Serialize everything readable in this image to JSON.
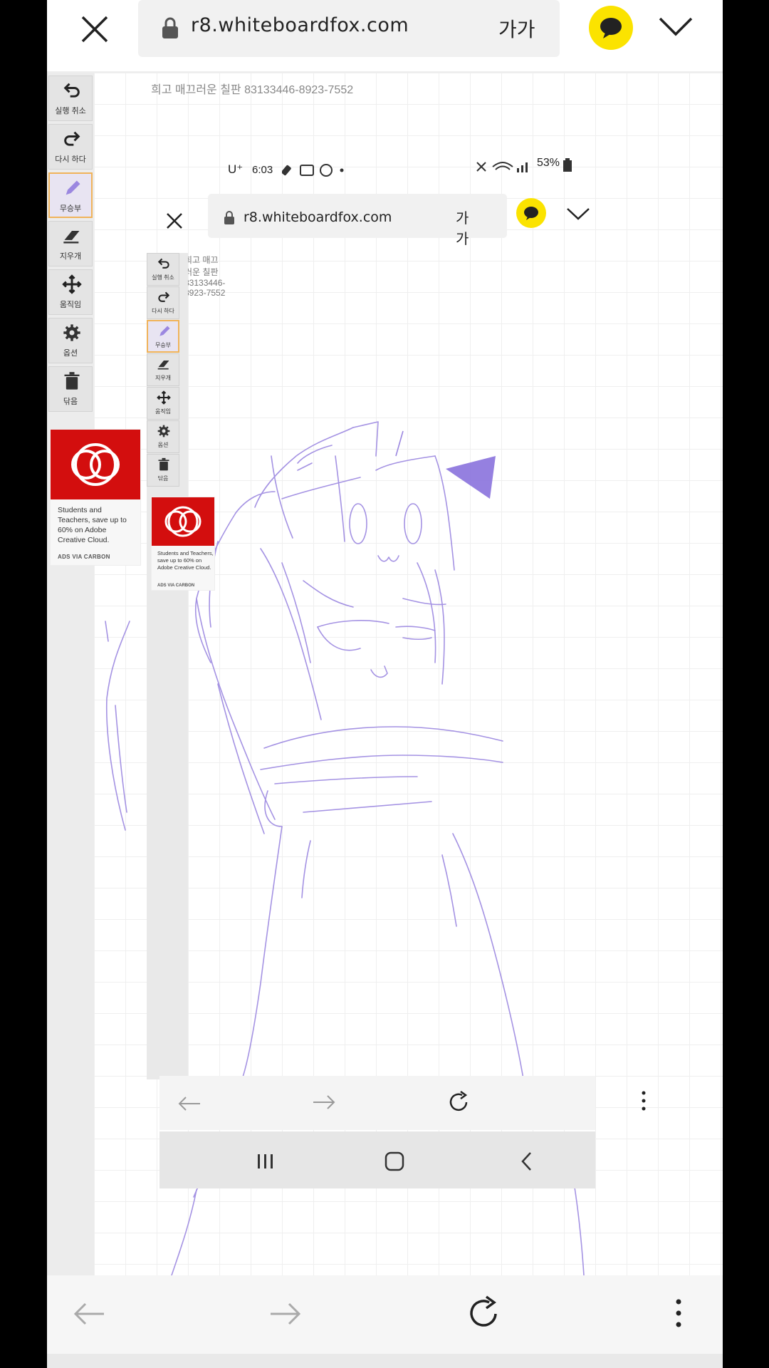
{
  "browser": {
    "url": "r8.whiteboardfox.com",
    "text_size_label": "가가",
    "icons": {
      "close": "close-icon",
      "lock": "lock-icon",
      "chat": "kakao-chat-icon",
      "menu": "chevron-down-icon",
      "back": "arrow-left-icon",
      "forward": "arrow-right-icon",
      "reload": "reload-icon",
      "more": "more-vert-icon"
    },
    "accent_yellow": "#fbe300"
  },
  "board": {
    "title": "희고 매끄러운 칠판 83133446-8923-7552",
    "stroke_color": "#9b87e0"
  },
  "toolbar": {
    "items": [
      {
        "label": "실행 취소",
        "icon": "undo-icon"
      },
      {
        "label": "다시 하다",
        "icon": "redo-icon"
      },
      {
        "label": "무승부",
        "icon": "pencil-icon",
        "active": true
      },
      {
        "label": "지우개",
        "icon": "eraser-icon"
      },
      {
        "label": "움직임",
        "icon": "move-icon"
      },
      {
        "label": "옵션",
        "icon": "gear-icon"
      },
      {
        "label": "닦음",
        "icon": "trash-icon"
      }
    ]
  },
  "ad": {
    "text": "Students and Teachers, save up to 60% on Adobe Creative Cloud.",
    "via": "ADS VIA CARBON",
    "brand_color": "#d30e0e"
  },
  "inner_screenshot": {
    "status_time": "6:03",
    "status_carrier": "U⁺",
    "status_battery": "53%",
    "url": "r8.whiteboardfox.com",
    "text_size_label": "가가",
    "title": "희고 매끄러운 칠판 83133446-8923-7552",
    "toolbar_labels": [
      "실행 취소",
      "다시 하다",
      "무승부",
      "지우개",
      "움직임",
      "옵션",
      "닦음"
    ],
    "ad_text": "Students and Teachers, save up to 60% on Adobe Creative Cloud.",
    "ad_via": "ADS VIA CARBON"
  }
}
